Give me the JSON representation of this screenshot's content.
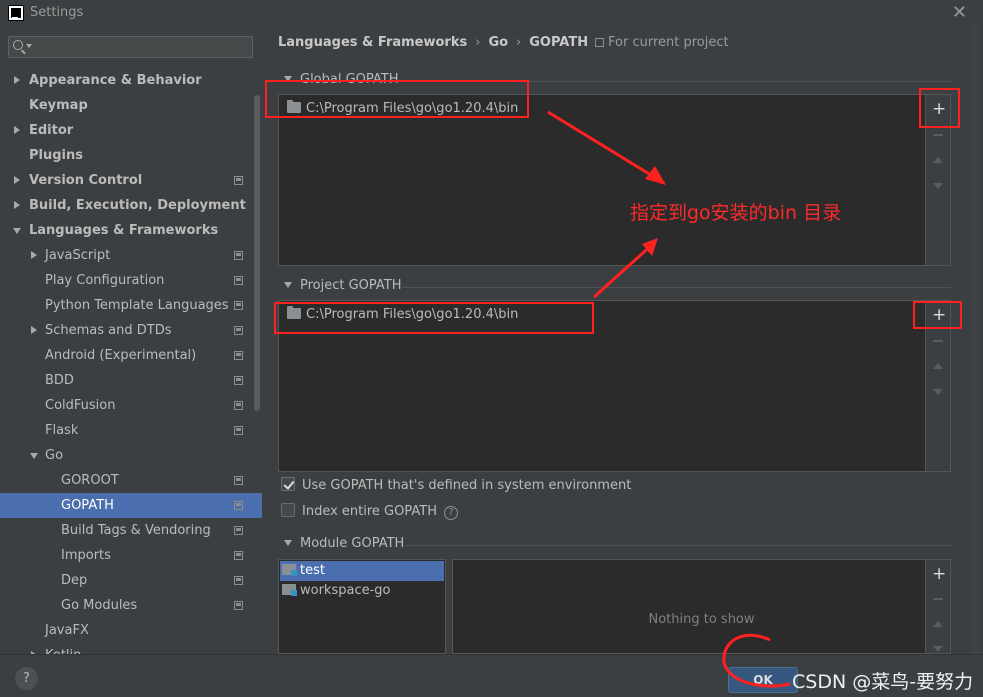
{
  "window": {
    "title": "Settings"
  },
  "search": {
    "placeholder": ""
  },
  "sidebar": {
    "items": [
      {
        "label": "Appearance & Behavior"
      },
      {
        "label": "Keymap"
      },
      {
        "label": "Editor"
      },
      {
        "label": "Plugins"
      },
      {
        "label": "Version Control"
      },
      {
        "label": "Build, Execution, Deployment"
      },
      {
        "label": "Languages & Frameworks"
      },
      {
        "label": "JavaScript"
      },
      {
        "label": "Play Configuration"
      },
      {
        "label": "Python Template Languages"
      },
      {
        "label": "Schemas and DTDs"
      },
      {
        "label": "Android (Experimental)"
      },
      {
        "label": "BDD"
      },
      {
        "label": "ColdFusion"
      },
      {
        "label": "Flask"
      },
      {
        "label": "Go"
      },
      {
        "label": "GOROOT"
      },
      {
        "label": "GOPATH"
      },
      {
        "label": "Build Tags & Vendoring"
      },
      {
        "label": "Imports"
      },
      {
        "label": "Dep"
      },
      {
        "label": "Go Modules"
      },
      {
        "label": "JavaFX"
      },
      {
        "label": "Kotlin"
      }
    ]
  },
  "breadcrumb": {
    "part1": "Languages & Frameworks",
    "sep": "›",
    "part2": "Go",
    "part3": "GOPATH"
  },
  "scope": {
    "label": "For current project"
  },
  "global_gopath": {
    "title": "Global GOPATH",
    "paths": [
      "C:\\Program Files\\go\\go1.20.4\\bin"
    ]
  },
  "project_gopath": {
    "title": "Project GOPATH",
    "paths": [
      "C:\\Program Files\\go\\go1.20.4\\bin"
    ]
  },
  "toolbar": {
    "add": "+"
  },
  "options": {
    "use_system_gopath": {
      "label": "Use GOPATH that's defined in system environment",
      "checked": true
    },
    "index_entire_gopath": {
      "label": "Index entire GOPATH",
      "checked": false,
      "help": "?"
    }
  },
  "module_gopath": {
    "title": "Module GOPATH",
    "modules": [
      "test",
      "workspace-go"
    ],
    "empty_text": "Nothing to show"
  },
  "buttons": {
    "ok": "OK",
    "help": "?"
  },
  "annotation": {
    "text": "指定到go安装的bin 目录",
    "color": "#ff2a2a"
  },
  "watermark": {
    "text": "CSDN @菜鸟-要努力"
  },
  "colors": {
    "selection": "#4b6eaf",
    "background": "#3c3f41",
    "list_background": "#2b2b2b",
    "annotation_red": "#ff2020"
  }
}
